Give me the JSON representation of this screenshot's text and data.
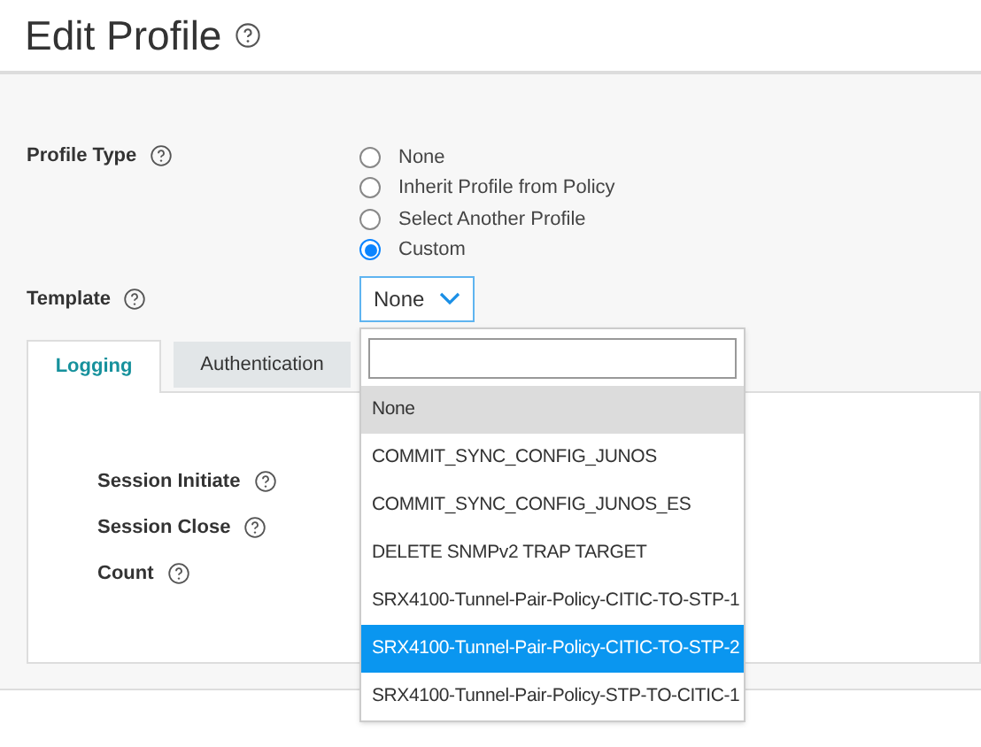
{
  "title": "Edit Profile",
  "profile_type": {
    "label": "Profile Type",
    "options": [
      {
        "label": "None",
        "selected": false
      },
      {
        "label": "Inherit Profile from Policy",
        "selected": false
      },
      {
        "label": "Select Another Profile",
        "selected": false
      },
      {
        "label": "Custom",
        "selected": true
      }
    ]
  },
  "template": {
    "label": "Template",
    "value": "None",
    "expanded": true
  },
  "dropdown": {
    "items": [
      {
        "label": "None",
        "highlighted": true,
        "selected": false
      },
      {
        "label": "COMMIT_SYNC_CONFIG_JUNOS",
        "highlighted": false,
        "selected": false
      },
      {
        "label": "COMMIT_SYNC_CONFIG_JUNOS_ES",
        "highlighted": false,
        "selected": false
      },
      {
        "label": "DELETE SNMPv2 TRAP TARGET",
        "highlighted": false,
        "selected": false
      },
      {
        "label": "SRX4100-Tunnel-Pair-Policy-CITIC-TO-STP-1",
        "highlighted": false,
        "selected": false
      },
      {
        "label": "SRX4100-Tunnel-Pair-Policy-CITIC-TO-STP-2",
        "highlighted": false,
        "selected": true
      },
      {
        "label": "SRX4100-Tunnel-Pair-Policy-STP-TO-CITIC-1",
        "highlighted": false,
        "selected": false
      }
    ]
  },
  "tabs": [
    {
      "label": "Logging",
      "selected": true
    },
    {
      "label": "Authentication",
      "selected": false
    }
  ],
  "fields": [
    {
      "label": "Session Initiate"
    },
    {
      "label": "Session Close"
    },
    {
      "label": "Count"
    }
  ]
}
